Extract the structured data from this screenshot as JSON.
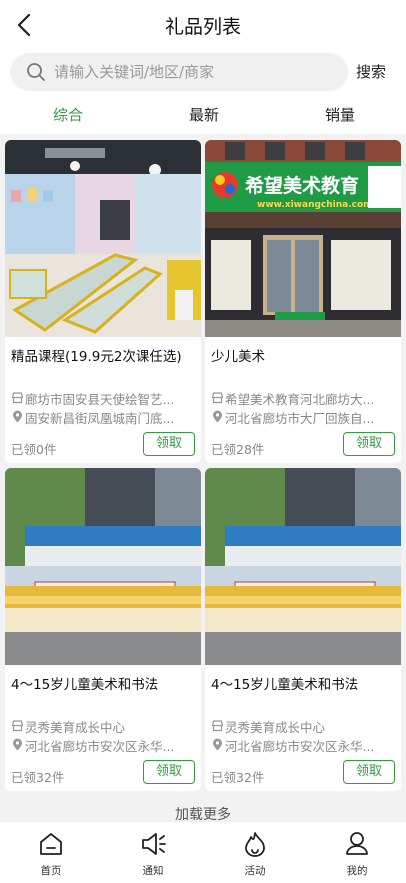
{
  "header": {
    "title": "礼品列表"
  },
  "search": {
    "placeholder": "请输入关键词/地区/商家",
    "value": "",
    "button_label": "搜索"
  },
  "tabs": [
    {
      "label": "综合",
      "active": true
    },
    {
      "label": "最新",
      "active": false
    },
    {
      "label": "销量",
      "active": false
    }
  ],
  "accent_color": "#2e9e3e",
  "gifts": [
    {
      "name": "精品课程(19.9元2次课任选)",
      "merchant": "廊坊市固安县天使绘智艺...",
      "address": "固安新昌街凤凰城南门底...",
      "received": "已领0件",
      "claim_label": "领取",
      "image": "classroom-photo"
    },
    {
      "name": "少儿美术",
      "merchant": "希望美术教育河北廊坊大...",
      "address": "河北省廊坊市大厂回族自...",
      "received": "已领28件",
      "claim_label": "领取",
      "image": "storefront-photo",
      "sign_text": "希望美术教育",
      "sign_sub": "www.xiwangchina.com"
    },
    {
      "name": "4～15岁儿童美术和书法",
      "merchant": "灵秀美育成长中心",
      "address": "河北省廊坊市安次区永华...",
      "received": "已领32件",
      "claim_label": "领取",
      "image": "group-photo"
    },
    {
      "name": "4～15岁儿童美术和书法",
      "merchant": "灵秀美育成长中心",
      "address": "河北省廊坊市安次区永华...",
      "received": "已领32件",
      "claim_label": "领取",
      "image": "group-photo"
    }
  ],
  "load_more": "加载更多",
  "bottom_nav": [
    {
      "label": "首页",
      "icon": "home-icon"
    },
    {
      "label": "通知",
      "icon": "speaker-icon"
    },
    {
      "label": "活动",
      "icon": "flame-icon"
    },
    {
      "label": "我的",
      "icon": "user-icon"
    }
  ]
}
